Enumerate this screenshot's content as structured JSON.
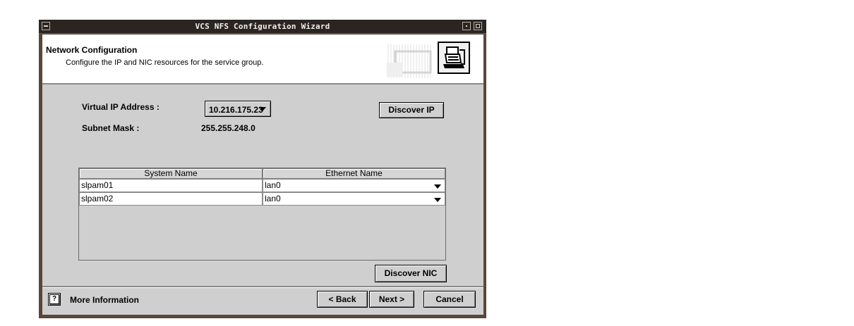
{
  "window": {
    "title": "VCS NFS Configuration Wizard"
  },
  "header": {
    "title": "Network Configuration",
    "subtitle": "Configure the IP and NIC resources for the service group."
  },
  "form": {
    "virtual_ip_label": "Virtual IP Address :",
    "virtual_ip_value": "10.216.175.23",
    "subnet_label": "Subnet Mask :",
    "subnet_value": "255.255.248.0",
    "discover_ip_label": "Discover IP",
    "discover_nic_label": "Discover NIC"
  },
  "table": {
    "columns": [
      "System Name",
      "Ethernet Name"
    ],
    "rows": [
      {
        "system": "slpam01",
        "ethernet": "lan0"
      },
      {
        "system": "slpam02",
        "ethernet": "lan0"
      }
    ]
  },
  "footer": {
    "more_info_label": "More Information",
    "back_label": "< Back",
    "next_label": "Next >",
    "cancel_label": "Cancel"
  },
  "icons": [
    "window-menu-icon",
    "minimize-icon",
    "maximize-icon",
    "wizard-icon",
    "help-icon",
    "dropdown-arrow-icon"
  ]
}
